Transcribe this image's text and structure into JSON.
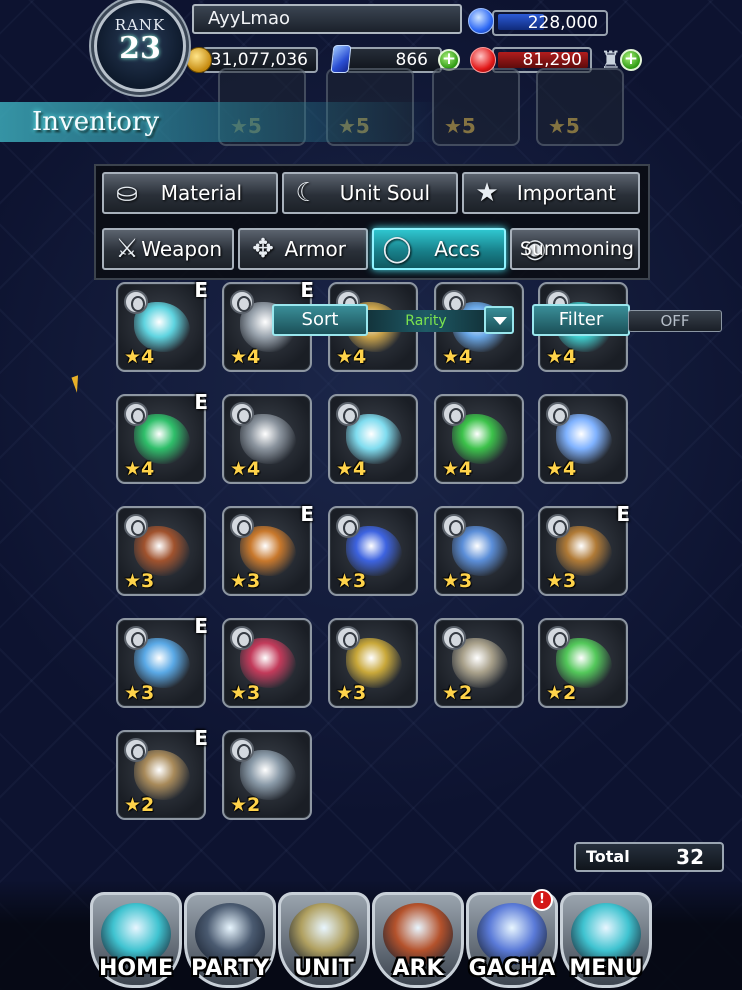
{
  "header": {
    "rank_label": "RANK",
    "rank_value": "23",
    "player_name": "AyyLmao",
    "energy": "228,000",
    "gil": "31,077,036",
    "lapis": "866",
    "visiore": "81,290"
  },
  "screen_title": "Inventory",
  "ghost_row": [
    {
      "rarity": "★5"
    },
    {
      "rarity": "★5"
    },
    {
      "rarity": "★5"
    },
    {
      "rarity": "★5"
    }
  ],
  "category_tabs": [
    {
      "label": "Material",
      "icon": "bag-icon",
      "active": false
    },
    {
      "label": "Unit Soul",
      "icon": "flame-icon",
      "active": false
    },
    {
      "label": "Important",
      "icon": "star-icon",
      "active": false
    },
    {
      "label": "Weapon",
      "icon": "sword-icon",
      "active": false
    },
    {
      "label": "Armor",
      "icon": "armor-icon",
      "active": false
    },
    {
      "label": "Accs",
      "icon": "ring-icon",
      "active": true
    },
    {
      "label": "Summoning",
      "icon": "orb-icon",
      "active": false
    }
  ],
  "sort": {
    "label": "Sort",
    "value": "Rarity"
  },
  "filter": {
    "label": "Filter",
    "value": "OFF"
  },
  "items": [
    {
      "rarity": "★4",
      "equipped": "E",
      "color": "#5fd4e0"
    },
    {
      "rarity": "★4",
      "equipped": "E",
      "color": "#9aa4ae"
    },
    {
      "rarity": "★4",
      "equipped": "",
      "color": "#c9a24a"
    },
    {
      "rarity": "★4",
      "equipped": "",
      "color": "#6aa8e8"
    },
    {
      "rarity": "★4",
      "equipped": "",
      "color": "#3fcfcf"
    },
    {
      "rarity": "★4",
      "equipped": "E",
      "color": "#2fbf6a"
    },
    {
      "rarity": "★4",
      "equipped": "",
      "color": "#8a939d"
    },
    {
      "rarity": "★4",
      "equipped": "",
      "color": "#7fdcef"
    },
    {
      "rarity": "★4",
      "equipped": "",
      "color": "#3cc24a"
    },
    {
      "rarity": "★4",
      "equipped": "",
      "color": "#7fb2ff"
    },
    {
      "rarity": "★3",
      "equipped": "",
      "color": "#a0522d"
    },
    {
      "rarity": "★3",
      "equipped": "E",
      "color": "#c8782c"
    },
    {
      "rarity": "★3",
      "equipped": "",
      "color": "#3d63e0"
    },
    {
      "rarity": "★3",
      "equipped": "",
      "color": "#5b8ed8"
    },
    {
      "rarity": "★3",
      "equipped": "E",
      "color": "#b07a36"
    },
    {
      "rarity": "★3",
      "equipped": "E",
      "color": "#5aa9e6"
    },
    {
      "rarity": "★3",
      "equipped": "",
      "color": "#c23a5a"
    },
    {
      "rarity": "★3",
      "equipped": "",
      "color": "#c9a83a"
    },
    {
      "rarity": "★2",
      "equipped": "",
      "color": "#a8a08a"
    },
    {
      "rarity": "★2",
      "equipped": "",
      "color": "#53c85a"
    },
    {
      "rarity": "★2",
      "equipped": "E",
      "color": "#a88a5a"
    },
    {
      "rarity": "★2",
      "equipped": "",
      "color": "#8a9aa8"
    }
  ],
  "total": {
    "label": "Total",
    "value": "32"
  },
  "nav": [
    {
      "label": "HOME",
      "color": "#3fc3d0",
      "badge": ""
    },
    {
      "label": "PARTY",
      "color": "#4a5a70",
      "badge": ""
    },
    {
      "label": "UNIT",
      "color": "#b0a060",
      "badge": ""
    },
    {
      "label": "ARK",
      "color": "#b4522c",
      "badge": ""
    },
    {
      "label": "GACHA",
      "color": "#5a7ad8",
      "badge": "!"
    },
    {
      "label": "MENU",
      "color": "#3fc3d0",
      "badge": ""
    }
  ]
}
